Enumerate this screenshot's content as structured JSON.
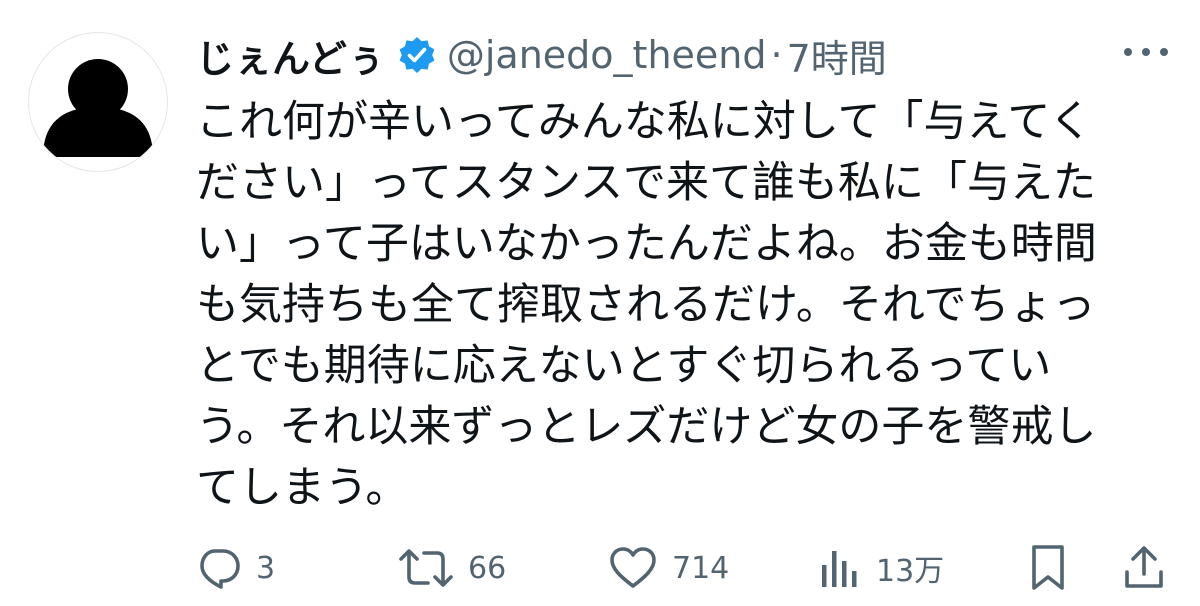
{
  "user": {
    "display_name": "じぇんどぅ",
    "handle": "@janedo_theend",
    "separator": "·",
    "time": "7時間"
  },
  "tweet": {
    "lines": [
      "これ何が辛いってみんな私に対して「与えてく",
      "ださい」ってスタンスで来て誰も私に「与えた",
      "い」って子はいなかったんだよね。お金も時間",
      "も気持ちも全て搾取されるだけ。それでちょっ",
      "とでも期待に応えないとすぐ切られるってい",
      "う。それ以来ずっとレズだけど女の子を警戒し",
      "てしまう。"
    ]
  },
  "actions": {
    "reply_count": "3",
    "retweet_count": "66",
    "like_count": "714",
    "views_count": "13万"
  },
  "colors": {
    "text": "#0f1419",
    "secondary": "#536471",
    "verified": "#1d9bf0"
  },
  "icons": [
    "avatar-silhouette",
    "verified-badge-icon",
    "more-icon",
    "reply-icon",
    "retweet-icon",
    "like-icon",
    "views-icon",
    "bookmark-icon",
    "share-icon"
  ]
}
